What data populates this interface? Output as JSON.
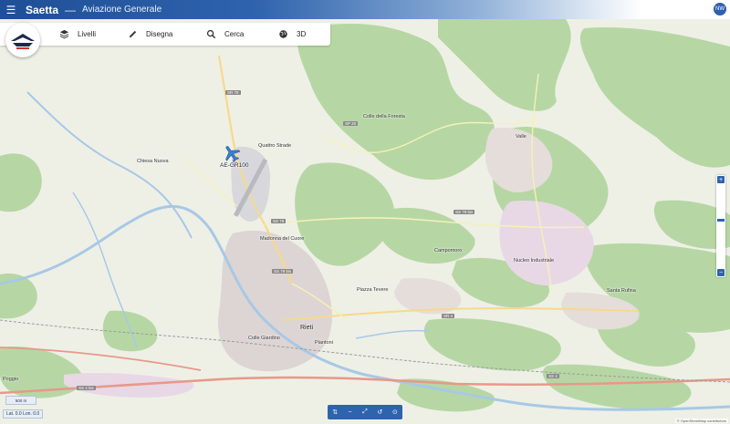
{
  "header": {
    "title": "Saetta",
    "separator": "—",
    "subtitle": "Aviazione Generale",
    "user_initials": "NW"
  },
  "toolbar": {
    "items": [
      {
        "label": "Livelli",
        "icon": "layers-icon"
      },
      {
        "label": "Disegna",
        "icon": "pencil-icon"
      },
      {
        "label": "Cerca",
        "icon": "search-icon"
      },
      {
        "label": "3D",
        "icon": "globe-icon"
      }
    ]
  },
  "map": {
    "aircraft": {
      "label": "AE-GR100",
      "color": "#3a7fd0"
    },
    "places": [
      "Quattro Strade",
      "Chiesa Nuova",
      "Madonna del Cuore",
      "Colle della Foresta",
      "Valle",
      "Campomoro",
      "Piazza Tevere",
      "Nucleo Industriale",
      "Santa Rufina",
      "Rieti",
      "Colle Giardino",
      "Piantoni",
      "Poggio"
    ],
    "roads": [
      "SR 79",
      "SS 4",
      "SP 20",
      "SS 79",
      "SS 79 bis",
      "SR 4",
      "SS 79 bis",
      "SS 4 bis"
    ],
    "colors": {
      "forest": "#b6d7a4",
      "land": "#eef0e6",
      "urban": "#dcd5d3",
      "residential": "#e4ddda",
      "industrial": "#e8d8e6",
      "water": "#a8c8e6",
      "motorway": "#e89888",
      "primary": "#f7d98c",
      "secondary": "#f6f1b8",
      "rail": "#9a9a9a"
    }
  },
  "controls": {
    "zoom_in": "+",
    "zoom_out": "−",
    "bottom_tools": [
      "⇅",
      "−",
      "⤢",
      "↺",
      "⊙"
    ],
    "coordinates": "Lat. 0.0 Lon. 0.0",
    "scale_label": "500 m",
    "attribution": "© OpenStreetMap contributors"
  }
}
